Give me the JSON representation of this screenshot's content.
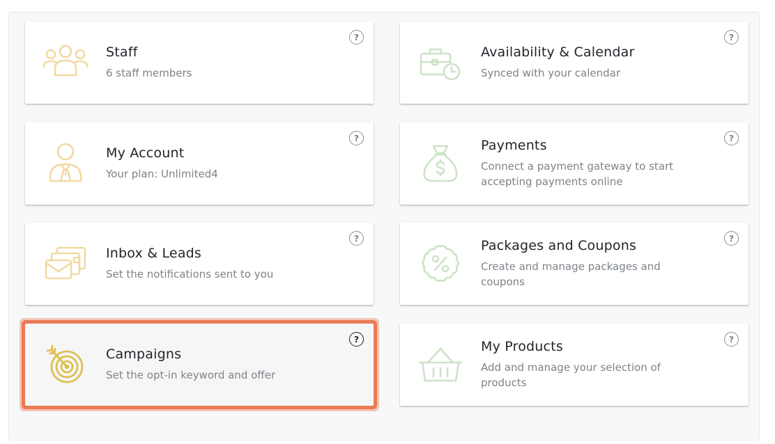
{
  "colors": {
    "highlight": "#e97b55",
    "icon_yellow": "#f2d9a2",
    "icon_green": "#cde3c8",
    "icon_gold": "#dcc050"
  },
  "help_symbol": "?",
  "cards": [
    {
      "title": "Staff",
      "description": "6 staff members",
      "icon": "people-icon"
    },
    {
      "title": "Availability & Calendar",
      "description": "Synced with your calendar",
      "icon": "briefcase-clock-icon"
    },
    {
      "title": "My Account",
      "description": "Your plan: Unlimited4",
      "icon": "user-tie-icon"
    },
    {
      "title": "Payments",
      "description": "Connect a payment gateway to start accepting payments online",
      "icon": "money-bag-icon"
    },
    {
      "title": "Inbox & Leads",
      "description": "Set the notifications sent to you",
      "icon": "envelope-cards-icon"
    },
    {
      "title": "Packages and Coupons",
      "description": "Create and manage packages and coupons",
      "icon": "discount-badge-icon"
    },
    {
      "title": "Campaigns",
      "description": "Set the opt-in keyword and offer",
      "icon": "target-icon",
      "selected": true
    },
    {
      "title": "My Products",
      "description": "Add and manage your selection of products",
      "icon": "basket-icon"
    }
  ]
}
